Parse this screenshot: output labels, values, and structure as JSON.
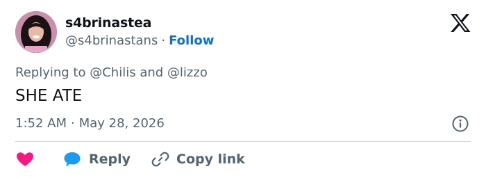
{
  "author": {
    "display_name": "s4brinastea",
    "handle": "@s4brinastans",
    "separator": "·",
    "follow_label": "Follow"
  },
  "reply_context": {
    "prefix": "Replying to",
    "mention_1": "@Chilis",
    "conjunction": "and",
    "mention_2": "@lizzo"
  },
  "tweet": {
    "text": "SHE ATE",
    "time": "1:52 AM",
    "separator": "·",
    "date": "May 28, 2026"
  },
  "actions": {
    "reply_label": "Reply",
    "copy_link_label": "Copy link"
  },
  "icons": {
    "platform": "x-logo-icon",
    "info": "info-icon",
    "like": "heart-icon",
    "reply": "speech-bubble-icon",
    "copy": "link-icon"
  },
  "colors": {
    "text_primary": "#0f1419",
    "text_secondary": "#536471",
    "follow": "#0a6fd6",
    "heart": "#f91880",
    "reply_icon": "#1d9bf0",
    "divider": "#cfd9de"
  }
}
